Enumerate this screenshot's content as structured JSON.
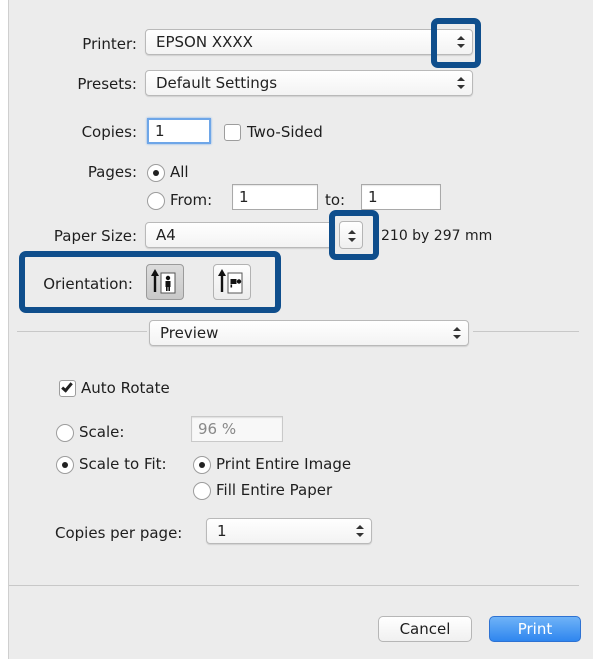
{
  "printer": {
    "label": "Printer:",
    "value": "EPSON XXXX"
  },
  "presets": {
    "label": "Presets:",
    "value": "Default Settings"
  },
  "copies": {
    "label": "Copies:",
    "value": "1",
    "two_sided_label": "Two-Sided",
    "two_sided_checked": false
  },
  "pages": {
    "label": "Pages:",
    "all_label": "All",
    "from_label": "From:",
    "from_value": "1",
    "to_label": "to:",
    "to_value": "1",
    "selected": "All"
  },
  "paper_size": {
    "label": "Paper Size:",
    "value": "A4",
    "dimensions": "210 by 297 mm"
  },
  "orientation": {
    "label": "Orientation:",
    "options": [
      "portrait-icon",
      "landscape-icon"
    ],
    "selected": "portrait"
  },
  "section": {
    "value": "Preview"
  },
  "preview": {
    "auto_rotate_label": "Auto Rotate",
    "auto_rotate_checked": true,
    "scale_label": "Scale:",
    "scale_value": "96 %",
    "scale_to_fit_label": "Scale to Fit:",
    "print_entire_image_label": "Print Entire Image",
    "fill_entire_paper_label": "Fill Entire Paper",
    "copies_per_page_label": "Copies per page:",
    "copies_per_page_value": "1"
  },
  "footer": {
    "cancel_label": "Cancel",
    "print_label": "Print"
  },
  "colors": {
    "highlight": "#0f4e8c",
    "default_button": "#2f86ef",
    "focus_ring": "#6ea6e8"
  }
}
